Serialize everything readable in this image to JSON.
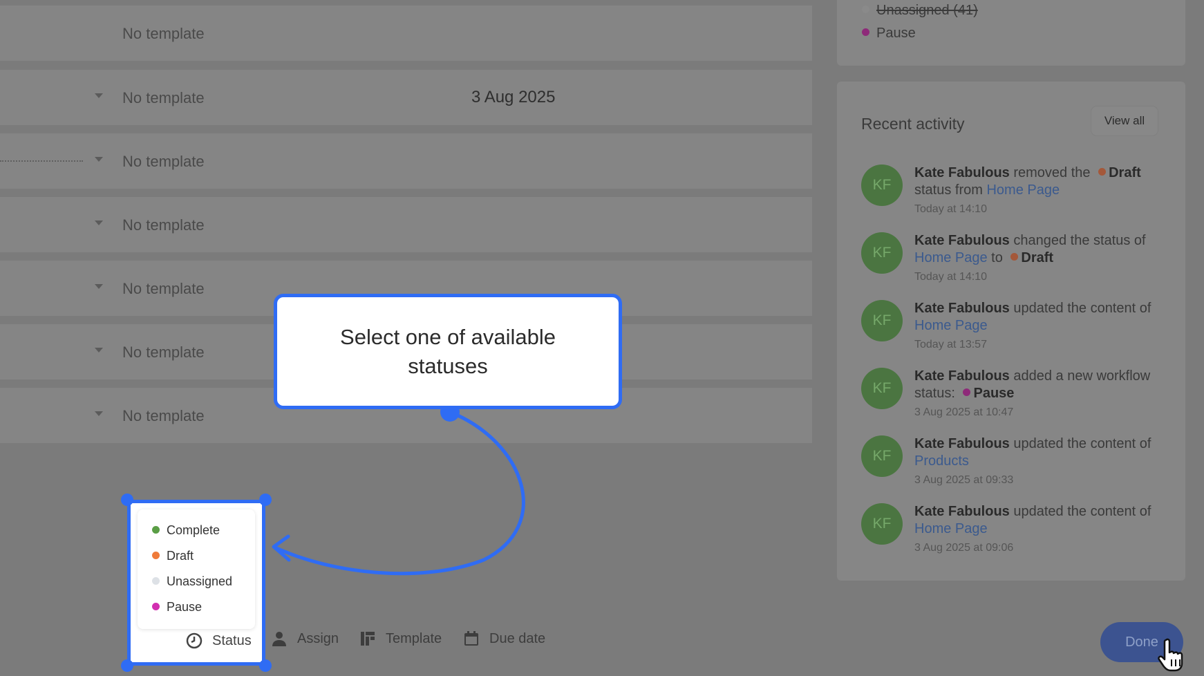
{
  "list": {
    "rows": [
      {
        "template": "No template",
        "date": "",
        "caret": false,
        "dots": false
      },
      {
        "template": "No template",
        "date": "3 Aug 2025",
        "caret": true,
        "dots": false
      },
      {
        "template": "No template",
        "date": "",
        "caret": true,
        "dots": true
      },
      {
        "template": "No template",
        "date": "",
        "caret": true,
        "dots": false
      },
      {
        "template": "No template",
        "date": "",
        "caret": true,
        "dots": false
      },
      {
        "template": "No template",
        "date": "",
        "caret": true,
        "dots": false
      },
      {
        "template": "No template",
        "date": "",
        "caret": true,
        "dots": false
      }
    ]
  },
  "status_legend": [
    {
      "label": "Unassigned (41)",
      "color": "#8a8a8a",
      "struck": true
    },
    {
      "label": "Pause",
      "color": "#8e2a79",
      "struck": false
    }
  ],
  "activity": {
    "title": "Recent activity",
    "view_all": "View all",
    "items": [
      {
        "initials": "KF",
        "user": "Kate Fabulous",
        "parts": [
          " removed the ",
          {
            "status": "Draft",
            "color": "#a4583a"
          },
          " status from ",
          {
            "link": "Home Page"
          }
        ],
        "time": "Today at 14:10"
      },
      {
        "initials": "KF",
        "user": "Kate Fabulous",
        "parts": [
          " changed the status of ",
          {
            "link": "Home Page"
          },
          " to ",
          {
            "status": "Draft",
            "color": "#a4583a"
          }
        ],
        "time": "Today at 14:10"
      },
      {
        "initials": "KF",
        "user": "Kate Fabulous",
        "parts": [
          " updated the content of ",
          {
            "link": "Home Page"
          }
        ],
        "time": "Today at 13:57"
      },
      {
        "initials": "KF",
        "user": "Kate Fabulous",
        "parts": [
          " added a new workflow status: ",
          {
            "status": "Pause",
            "color": "#8e2a79"
          }
        ],
        "time": "3 Aug 2025 at 10:47"
      },
      {
        "initials": "KF",
        "user": "Kate Fabulous",
        "parts": [
          " updated the content of ",
          {
            "link": "Products"
          }
        ],
        "time": "3 Aug 2025 at 09:33"
      },
      {
        "initials": "KF",
        "user": "Kate Fabulous",
        "parts": [
          " updated the content of ",
          {
            "link": "Home Page"
          }
        ],
        "time": "3 Aug 2025 at 09:06"
      }
    ]
  },
  "status_menu": {
    "options": [
      {
        "label": "Complete",
        "color": "#5a9e45"
      },
      {
        "label": "Draft",
        "color": "#ef7b3a"
      },
      {
        "label": "Unassigned",
        "color": "#dde1e6"
      },
      {
        "label": "Pause",
        "color": "#d22fb0"
      }
    ]
  },
  "toolbar": {
    "status": "Status",
    "assign": "Assign",
    "template": "Template",
    "due_date": "Due date",
    "done": "Done"
  },
  "callout": {
    "text": "Select one of available statuses"
  },
  "colors": {
    "accent": "#2f6cf4"
  }
}
